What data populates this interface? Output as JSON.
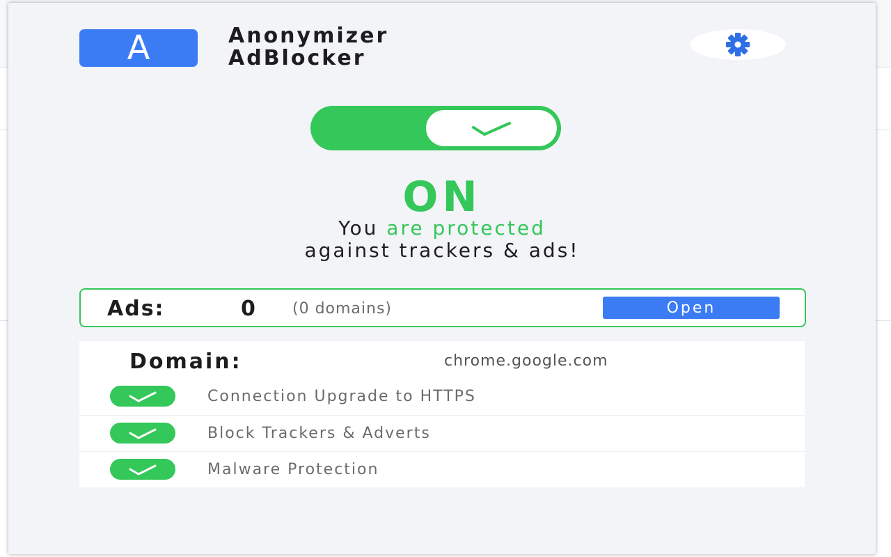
{
  "app": {
    "logo_letter": "A",
    "title_line1": "Anonymizer",
    "title_line2": "AdBlocker"
  },
  "settings": {
    "icon": "gear-icon"
  },
  "protection": {
    "toggle_on": true,
    "state_label": "ON",
    "tagline_prefix": "You ",
    "tagline_highlight": "are protected",
    "tagline_line2": "against trackers & ads!"
  },
  "ads": {
    "label": "Ads:",
    "count": "0",
    "domains_text": "(0 domains)",
    "open_label": "Open"
  },
  "domain": {
    "label": "Domain:",
    "value": "chrome.google.com"
  },
  "features": [
    {
      "label": "Connection Upgrade to HTTPS",
      "enabled": true
    },
    {
      "label": "Block Trackers & Adverts",
      "enabled": true
    },
    {
      "label": "Malware Protection",
      "enabled": true
    }
  ],
  "colors": {
    "accent_green": "#34c759",
    "accent_blue": "#3b7cf5",
    "popup_bg": "#f3f4f8"
  }
}
